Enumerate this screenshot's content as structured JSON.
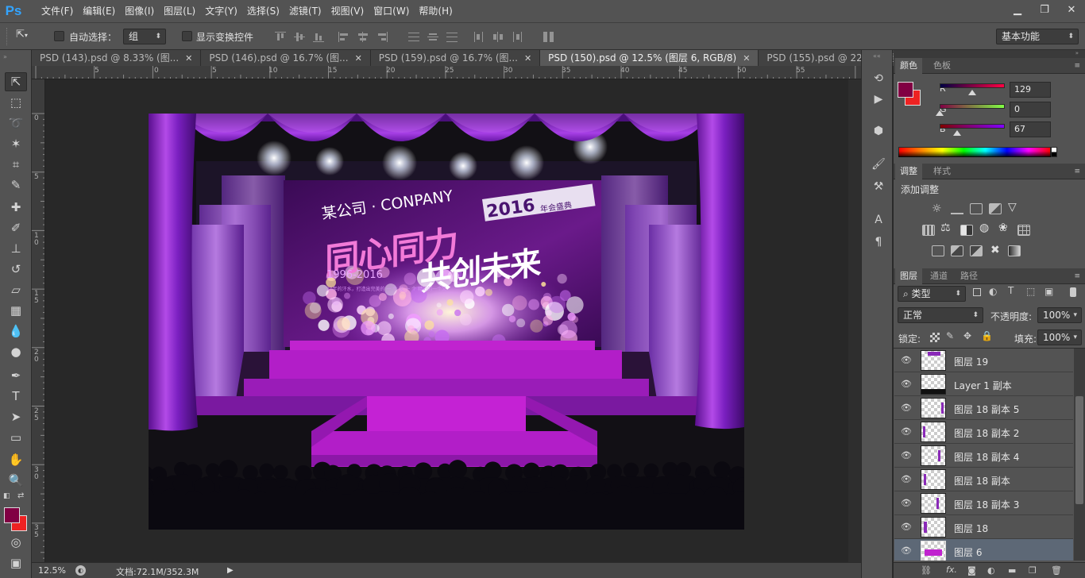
{
  "app": {
    "logo": "Ps"
  },
  "menu": [
    "文件(F)",
    "编辑(E)",
    "图像(I)",
    "图层(L)",
    "文字(Y)",
    "选择(S)",
    "滤镜(T)",
    "视图(V)",
    "窗口(W)",
    "帮助(H)"
  ],
  "window_controls": {
    "minimize": "▁",
    "restore": "❐",
    "close": "✕"
  },
  "options": {
    "auto_select_label": "自动选择：",
    "auto_select_value": "组",
    "show_transform_label": "显示变换控件",
    "workspace": "基本功能"
  },
  "tabs": [
    {
      "label": "PSD (143).psd @ 8.33% (图...",
      "close": "✕"
    },
    {
      "label": "PSD (146).psd @ 16.7% (图...",
      "close": "✕"
    },
    {
      "label": "PSD (159).psd @ 16.7% (图...",
      "close": "✕"
    },
    {
      "label": "PSD (150).psd @ 12.5% (图层 6, RGB/8)",
      "close": "✕"
    },
    {
      "label": "PSD (155).psd @ 22% (图层...",
      "close": "✕"
    }
  ],
  "ruler_h": [
    "5",
    "0",
    "5",
    "10",
    "15",
    "20",
    "25",
    "30",
    "35",
    "40",
    "45",
    "50",
    "55"
  ],
  "ruler_v": [
    "0",
    "5",
    "1\n0",
    "1\n5",
    "2\n0",
    "2\n5",
    "3\n0",
    "3\n5"
  ],
  "artwork": {
    "company": "某公司 · CONPANY",
    "year": "2016",
    "event": "年会盛典",
    "slogan1": "同心同力",
    "slogan2": "共创未来",
    "years_range": "1996-2016",
    "tagline": "20年的汗水，打造出完美的 一 个 又 一 个 精彩的一个又"
  },
  "status": {
    "zoom": "12.5%",
    "doc_size": "文档:72.1M/352.3M"
  },
  "color_panel": {
    "tabs": [
      "颜色",
      "色板"
    ],
    "channels": [
      {
        "label": "R",
        "value": "129",
        "frac": 0.506
      },
      {
        "label": "G",
        "value": "0",
        "frac": 0.0
      },
      {
        "label": "B",
        "value": "67",
        "frac": 0.263
      }
    ],
    "foreground": "#810043",
    "background": "#ee2222"
  },
  "adjust_panel": {
    "tabs": [
      "调整",
      "样式"
    ],
    "title": "添加调整"
  },
  "layers_panel": {
    "tabs": [
      "图层",
      "通道",
      "路径"
    ],
    "filter_kind": "类型",
    "blend_mode": "正常",
    "opacity_label": "不透明度:",
    "opacity_value": "100%",
    "lock_label": "锁定:",
    "fill_label": "填充:",
    "fill_value": "100%",
    "layers": [
      {
        "name": "图层 19",
        "visible": "👁"
      },
      {
        "name": "Layer 1 副本",
        "visible": "👁"
      },
      {
        "name": "图层 18 副本 5",
        "visible": "👁"
      },
      {
        "name": "图层 18 副本 2",
        "visible": "👁"
      },
      {
        "name": "图层 18 副本 4",
        "visible": "👁"
      },
      {
        "name": "图层 18 副本",
        "visible": "👁"
      },
      {
        "name": "图层 18 副本 3",
        "visible": "👁"
      },
      {
        "name": "图层 18",
        "visible": "👁"
      },
      {
        "name": "图层 6",
        "visible": "👁"
      }
    ]
  }
}
